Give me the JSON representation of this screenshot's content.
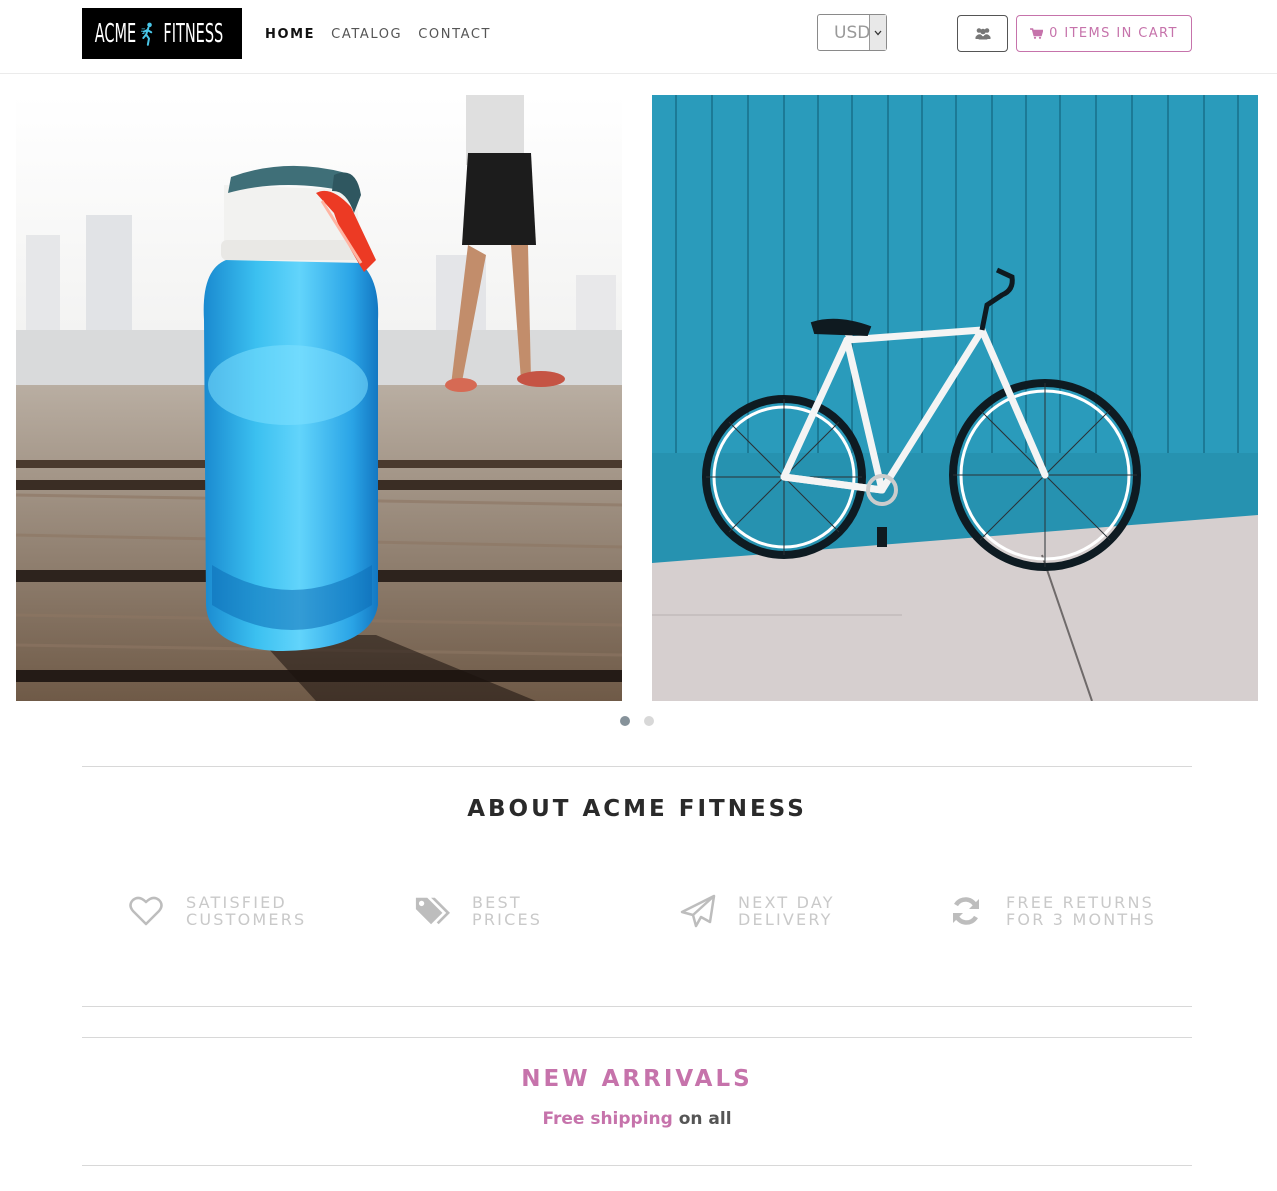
{
  "brand": {
    "logo_left": "ACME",
    "logo_right": "FITNESS"
  },
  "nav": {
    "items": [
      {
        "label": "HOME",
        "active": true
      },
      {
        "label": "CATALOG",
        "active": false
      },
      {
        "label": "CONTACT",
        "active": false
      }
    ]
  },
  "currency": {
    "selected": "USD"
  },
  "cart": {
    "label": "0 ITEMS IN CART",
    "count": 0
  },
  "carousel": {
    "slide_count": 2,
    "active_index": 0
  },
  "about": {
    "title": "ABOUT ACME FITNESS",
    "features": [
      {
        "line1": "SATISFIED",
        "line2": "CUSTOMERS",
        "icon": "heart-icon"
      },
      {
        "line1": "BEST",
        "line2": "PRICES",
        "icon": "tags-icon"
      },
      {
        "line1": "NEXT DAY",
        "line2": "DELIVERY",
        "icon": "paper-plane-icon"
      },
      {
        "line1": "FREE RETURNS",
        "line2": "FOR 3 MONTHS",
        "icon": "refresh-icon"
      }
    ]
  },
  "arrivals": {
    "title": "NEW ARRIVALS",
    "shipping_highlight": "Free shipping",
    "shipping_rest": "on all"
  },
  "colors": {
    "accent": "#c673ab",
    "muted_text": "#c9c9c9",
    "heading": "#2a2a2a"
  }
}
